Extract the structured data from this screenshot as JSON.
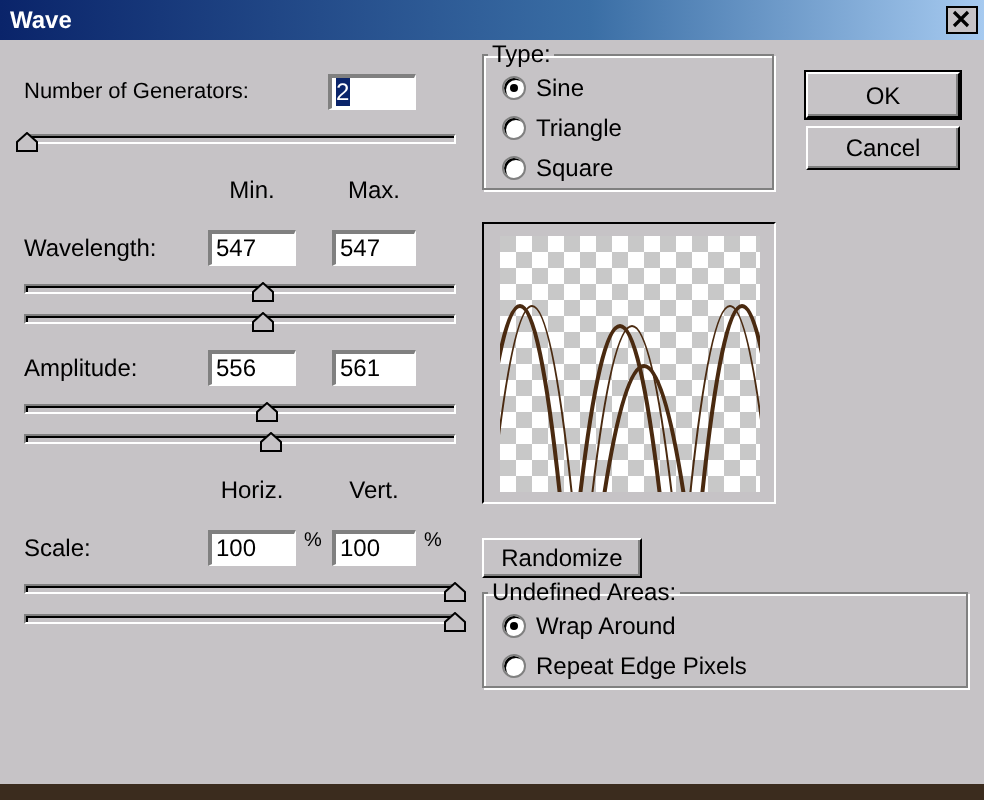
{
  "window": {
    "title": "Wave"
  },
  "generators": {
    "label": "Number of Generators:",
    "value": "2",
    "value_selected": true,
    "level": 0
  },
  "groups": [
    {
      "headings": [
        "Min.",
        "Max."
      ],
      "params": [
        {
          "label": "Wavelength:",
          "fields": [
            {
              "value": "547",
              "level": 0.55
            },
            {
              "value": "547",
              "level": 0.55
            }
          ]
        },
        {
          "label": "Amplitude:",
          "fields": [
            {
              "value": "556",
              "level": 0.56
            },
            {
              "value": "561",
              "level": 0.57
            }
          ]
        }
      ]
    },
    {
      "headings": [
        "Horiz.",
        "Vert."
      ],
      "params": [
        {
          "label": "Scale:",
          "fields": [
            {
              "value": "100",
              "unit": "%",
              "level": 1
            },
            {
              "value": "100",
              "unit": "%",
              "level": 1
            }
          ]
        }
      ]
    }
  ],
  "type": {
    "title": "Type:",
    "options": [
      {
        "label": "Sine",
        "selected": true
      },
      {
        "label": "Triangle",
        "selected": false
      },
      {
        "label": "Square",
        "selected": false
      }
    ]
  },
  "buttons": [
    {
      "label": "OK",
      "default": true
    },
    {
      "label": "Cancel",
      "default": false
    }
  ],
  "randomize": "Randomize",
  "undefined_areas": {
    "title": "Undefined Areas:",
    "options": [
      {
        "label": "Wrap Around",
        "selected": true
      },
      {
        "label": "Repeat Edge Pixels",
        "selected": false
      }
    ]
  }
}
